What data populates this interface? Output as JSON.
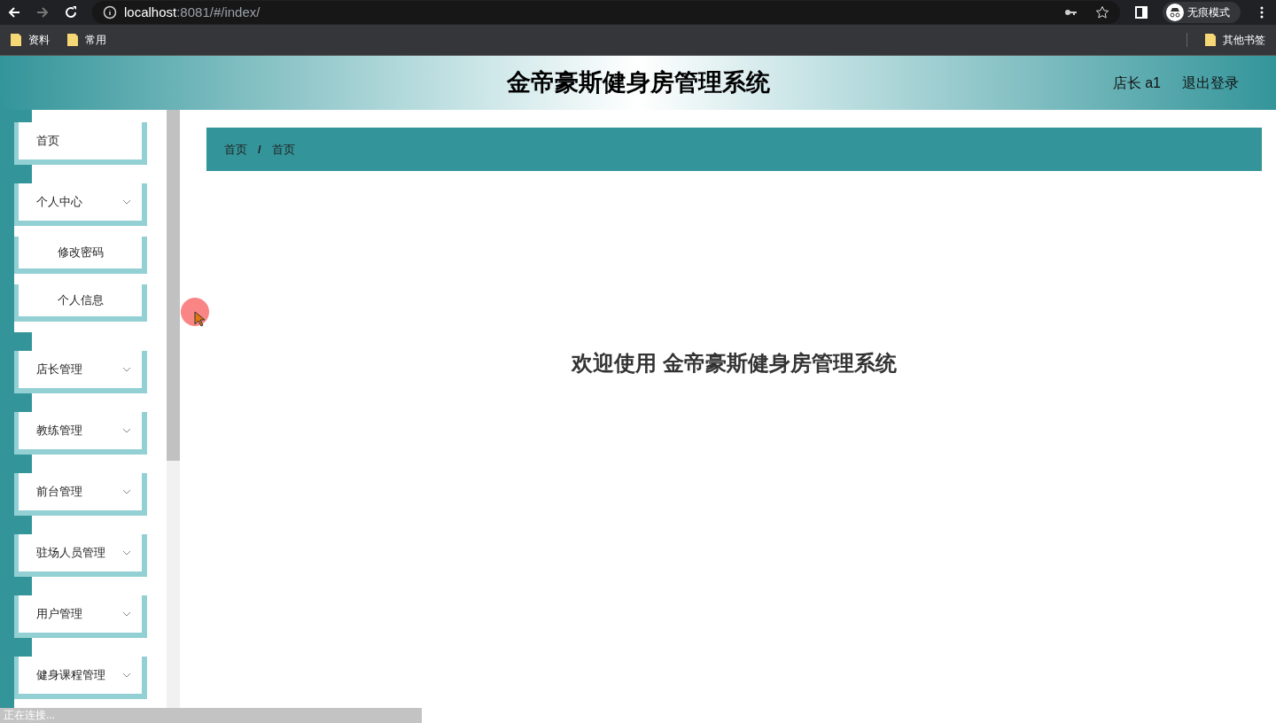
{
  "browser": {
    "url_host": "localhost",
    "url_path": ":8081/#/index/",
    "profile_label": "无痕模式",
    "bookmarks": [
      "资料",
      "常用"
    ],
    "other_bookmarks": "其他书签"
  },
  "header": {
    "title": "金帝豪斯健身房管理系统",
    "user": "店长 a1",
    "logout": "退出登录"
  },
  "menu": [
    {
      "label": "首页",
      "kind": "link"
    },
    {
      "label": "个人中心",
      "kind": "group",
      "children": [
        {
          "label": "修改密码"
        },
        {
          "label": "个人信息"
        }
      ]
    },
    {
      "label": "店长管理",
      "kind": "group"
    },
    {
      "label": "教练管理",
      "kind": "group"
    },
    {
      "label": "前台管理",
      "kind": "group"
    },
    {
      "label": "驻场人员管理",
      "kind": "group"
    },
    {
      "label": "用户管理",
      "kind": "group"
    },
    {
      "label": "健身课程管理",
      "kind": "group"
    }
  ],
  "breadcrumb": {
    "separator": "/",
    "items": [
      {
        "label": "首页"
      },
      {
        "label": "首页"
      }
    ]
  },
  "welcome": "欢迎使用 金帝豪斯健身房管理系统",
  "status_bar": "正在连接..."
}
